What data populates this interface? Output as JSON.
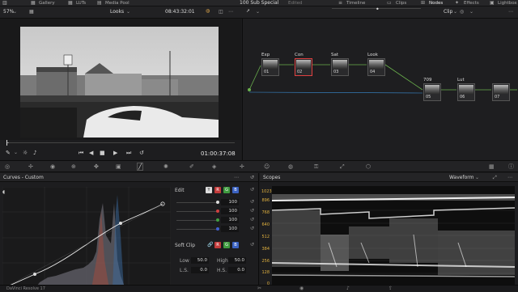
{
  "topbar": {
    "gallery": "Gallery",
    "luts": "LUTs",
    "media_pool": "Media Pool",
    "project_title": "100 Sub Special",
    "edited": "Edited",
    "timeline": "Timeline",
    "clips": "Clips",
    "nodes": "Nodes",
    "effects": "Effects",
    "lightbox": "Lightbox"
  },
  "viewer": {
    "zoom": "57%",
    "mode": "Looks",
    "timecode_top": "08:43:32:01",
    "timecode_bottom": "01:00:37:08",
    "scrub_progress": 0.01
  },
  "node_editor": {
    "mode": "Clip",
    "nodes": [
      {
        "label": "Exp",
        "id": "01"
      },
      {
        "label": "Con",
        "id": "02"
      },
      {
        "label": "Sat",
        "id": "03"
      },
      {
        "label": "Look",
        "id": "04"
      },
      {
        "label": "709",
        "id": "05"
      },
      {
        "label": "Lut",
        "id": "06"
      },
      {
        "label": "",
        "id": "07"
      }
    ]
  },
  "curves": {
    "title": "Curves - Custom",
    "edit_label": "Edit",
    "channels": [
      "Y",
      "R",
      "G",
      "B"
    ],
    "intensity": [
      "100",
      "100",
      "100",
      "100"
    ],
    "soft_clip_label": "Soft Clip",
    "low_label": "Low",
    "low_value": "50.0",
    "high_label": "High",
    "high_value": "50.0",
    "ls_label": "L.S.",
    "ls_value": "0.0",
    "hs_label": "H.S.",
    "hs_value": "0.0"
  },
  "scopes": {
    "title": "Scopes",
    "type": "Waveform",
    "scale": [
      "1023",
      "896",
      "768",
      "640",
      "512",
      "384",
      "256",
      "128",
      "0"
    ]
  },
  "footer": {
    "app": "DaVinci Resolve 17"
  },
  "colors": {
    "accent_red": "#e04040",
    "node_green": "#6ab04c",
    "node_blue": "#3a8fd6",
    "scope_bg": "#0e0e0e"
  }
}
